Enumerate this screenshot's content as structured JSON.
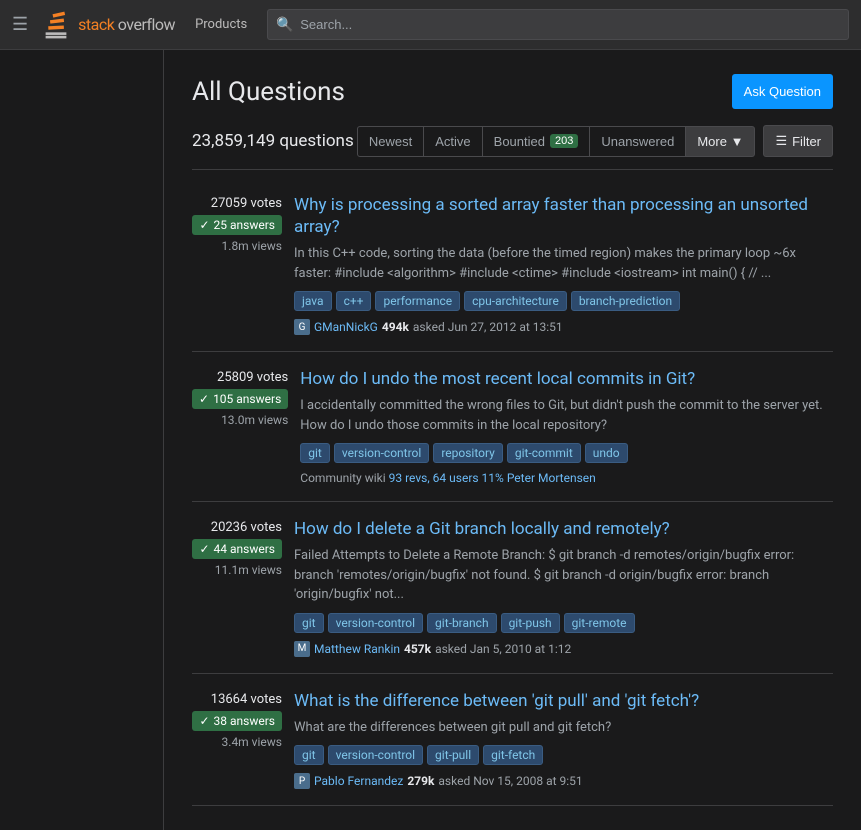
{
  "nav": {
    "products_label": "Products",
    "search_placeholder": "Search...",
    "logo_text": "stack overflow"
  },
  "page": {
    "title": "All Questions",
    "ask_button": "Ask Question",
    "questions_count": "23,859,149 questions"
  },
  "tabs": [
    {
      "id": "newest",
      "label": "Newest",
      "active": false
    },
    {
      "id": "active",
      "label": "Active",
      "active": false
    },
    {
      "id": "bountied",
      "label": "Bountied",
      "badge": "203",
      "active": false
    },
    {
      "id": "unanswered",
      "label": "Unanswered",
      "active": false
    },
    {
      "id": "more",
      "label": "More",
      "active": false
    }
  ],
  "filter_btn": "Filter",
  "questions": [
    {
      "id": "q1",
      "votes": "27059 votes",
      "answers": "25 answers",
      "views": "1.8m views",
      "title": "Why is processing a sorted array faster than processing an unsorted array?",
      "excerpt": "In this C++ code, sorting the data (before the timed region) makes the primary loop ~6x faster: #include <algorithm> #include <ctime> #include <iostream> int main() { // ...",
      "tags": [
        "java",
        "c++",
        "performance",
        "cpu-architecture",
        "branch-prediction"
      ],
      "author": "GManNickG",
      "author_rep": "494k",
      "date": "asked Jun 27, 2012 at 13:51",
      "community_wiki": false
    },
    {
      "id": "q2",
      "votes": "25809 votes",
      "answers": "105 answers",
      "views": "13.0m views",
      "title": "How do I undo the most recent local commits in Git?",
      "excerpt": "I accidentally committed the wrong files to Git, but didn't push the commit to the server yet. How do I undo those commits in the local repository?",
      "tags": [
        "git",
        "version-control",
        "repository",
        "git-commit",
        "undo"
      ],
      "author": null,
      "community_wiki": true,
      "community_wiki_text": "Community wiki",
      "community_wiki_revs": "93 revs, 64 users 11%",
      "community_wiki_user": "Peter Mortensen"
    },
    {
      "id": "q3",
      "votes": "20236 votes",
      "answers": "44 answers",
      "views": "11.1m views",
      "title": "How do I delete a Git branch locally and remotely?",
      "excerpt": "Failed Attempts to Delete a Remote Branch: $ git branch -d remotes/origin/bugfix error: branch 'remotes/origin/bugfix' not found. $ git branch -d origin/bugfix error: branch 'origin/bugfix' not...",
      "tags": [
        "git",
        "version-control",
        "git-branch",
        "git-push",
        "git-remote"
      ],
      "author": "Matthew Rankin",
      "author_rep": "457k",
      "date": "asked Jan 5, 2010 at 1:12",
      "community_wiki": false
    },
    {
      "id": "q4",
      "votes": "13664 votes",
      "answers": "38 answers",
      "views": "3.4m views",
      "title": "What is the difference between 'git pull' and 'git fetch'?",
      "excerpt": "What are the differences between git pull and git fetch?",
      "tags": [
        "git",
        "version-control",
        "git-pull",
        "git-fetch"
      ],
      "author": "Pablo Fernandez",
      "author_rep": "279k",
      "date": "asked Nov 15, 2008 at 9:51",
      "community_wiki": false
    }
  ]
}
